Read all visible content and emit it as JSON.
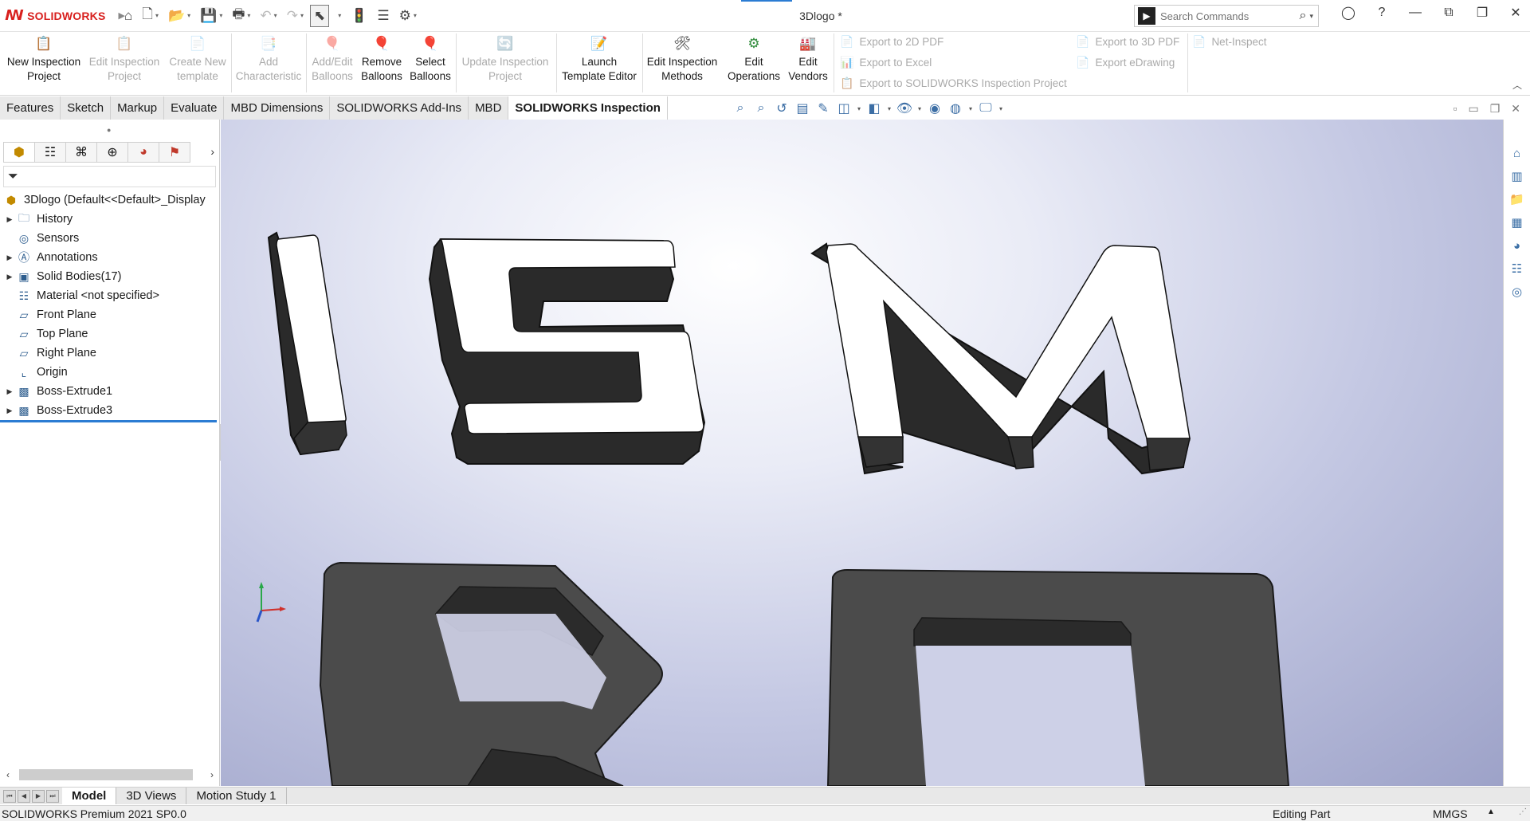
{
  "app": {
    "brand": "SOLIDWORKS",
    "document_title": "3Dlogo *"
  },
  "search": {
    "placeholder": "Search Commands"
  },
  "ribbon": {
    "new_inspection_project": "New Inspection Project",
    "edit_inspection_project": "Edit Inspection Project",
    "create_new_template": "Create New template",
    "add_characteristic": "Add Characteristic",
    "add_edit_balloons": "Add/Edit Balloons",
    "remove_balloons": "Remove Balloons",
    "select_balloons": "Select Balloons",
    "update_inspection_project": "Update Inspection Project",
    "launch_template_editor": "Launch Template Editor",
    "edit_inspection_methods": "Edit Inspection Methods",
    "edit_operations": "Edit Operations",
    "edit_vendors": "Edit Vendors",
    "export_2d_pdf": "Export to 2D PDF",
    "export_excel": "Export to Excel",
    "export_sw_inspection": "Export to SOLIDWORKS Inspection Project",
    "export_3d_pdf": "Export to 3D PDF",
    "export_edrawing": "Export eDrawing",
    "net_inspect": "Net-Inspect"
  },
  "cm_tabs": [
    "Features",
    "Sketch",
    "Markup",
    "Evaluate",
    "MBD Dimensions",
    "SOLIDWORKS Add-Ins",
    "MBD",
    "SOLIDWORKS Inspection"
  ],
  "active_cm_tab": "SOLIDWORKS Inspection",
  "feature_tree": {
    "root": "3Dlogo  (Default<<Default>_Display",
    "items": [
      {
        "label": "History",
        "icon": "history-folder-icon",
        "expandable": true
      },
      {
        "label": "Sensors",
        "icon": "sensors-icon",
        "expandable": false
      },
      {
        "label": "Annotations",
        "icon": "annotations-icon",
        "expandable": true
      },
      {
        "label": "Solid Bodies(17)",
        "icon": "solid-bodies-icon",
        "expandable": true
      },
      {
        "label": "Material <not specified>",
        "icon": "material-icon",
        "expandable": false
      },
      {
        "label": "Front Plane",
        "icon": "plane-icon",
        "expandable": false
      },
      {
        "label": "Top Plane",
        "icon": "plane-icon",
        "expandable": false
      },
      {
        "label": "Right Plane",
        "icon": "plane-icon",
        "expandable": false
      },
      {
        "label": "Origin",
        "icon": "origin-icon",
        "expandable": false
      },
      {
        "label": "Boss-Extrude1",
        "icon": "extrude-icon",
        "expandable": true
      },
      {
        "label": "Boss-Extrude3",
        "icon": "extrude-icon",
        "expandable": true
      }
    ]
  },
  "bottom_tabs": [
    "Model",
    "3D Views",
    "Motion Study 1"
  ],
  "active_bottom_tab": "Model",
  "status": {
    "product": "SOLIDWORKS Premium 2021 SP0.0",
    "mode": "Editing Part",
    "units": "MMGS"
  },
  "colors": {
    "accent": "#2b7cd3",
    "brand_red": "#d8201e",
    "letter_face": "#ffffff",
    "letter_side": "#2a2a2a",
    "base_face": "#4a4a4a"
  }
}
